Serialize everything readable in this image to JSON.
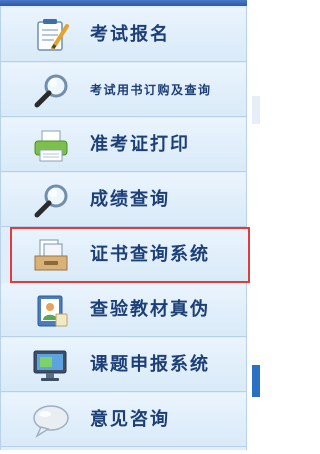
{
  "menu": {
    "items": [
      {
        "label": "考试报名",
        "icon": "signup-notepad-icon"
      },
      {
        "label": "考试用书订购及查询",
        "icon": "magnifier-icon"
      },
      {
        "label": "准考证打印",
        "icon": "printer-icon"
      },
      {
        "label": "成绩查询",
        "icon": "magnifier-icon"
      },
      {
        "label": "证书查询系统",
        "icon": "certificate-tray-icon"
      },
      {
        "label": "查验教材真伪",
        "icon": "textbook-verify-icon"
      },
      {
        "label": "课题申报系统",
        "icon": "monitor-icon"
      },
      {
        "label": "意见咨询",
        "icon": "chat-bubble-icon"
      }
    ],
    "selected_index": 4
  },
  "colors": {
    "menu_bg": "#dfeefa",
    "text": "#1d3f77",
    "selection_outline": "#e23b3b"
  }
}
